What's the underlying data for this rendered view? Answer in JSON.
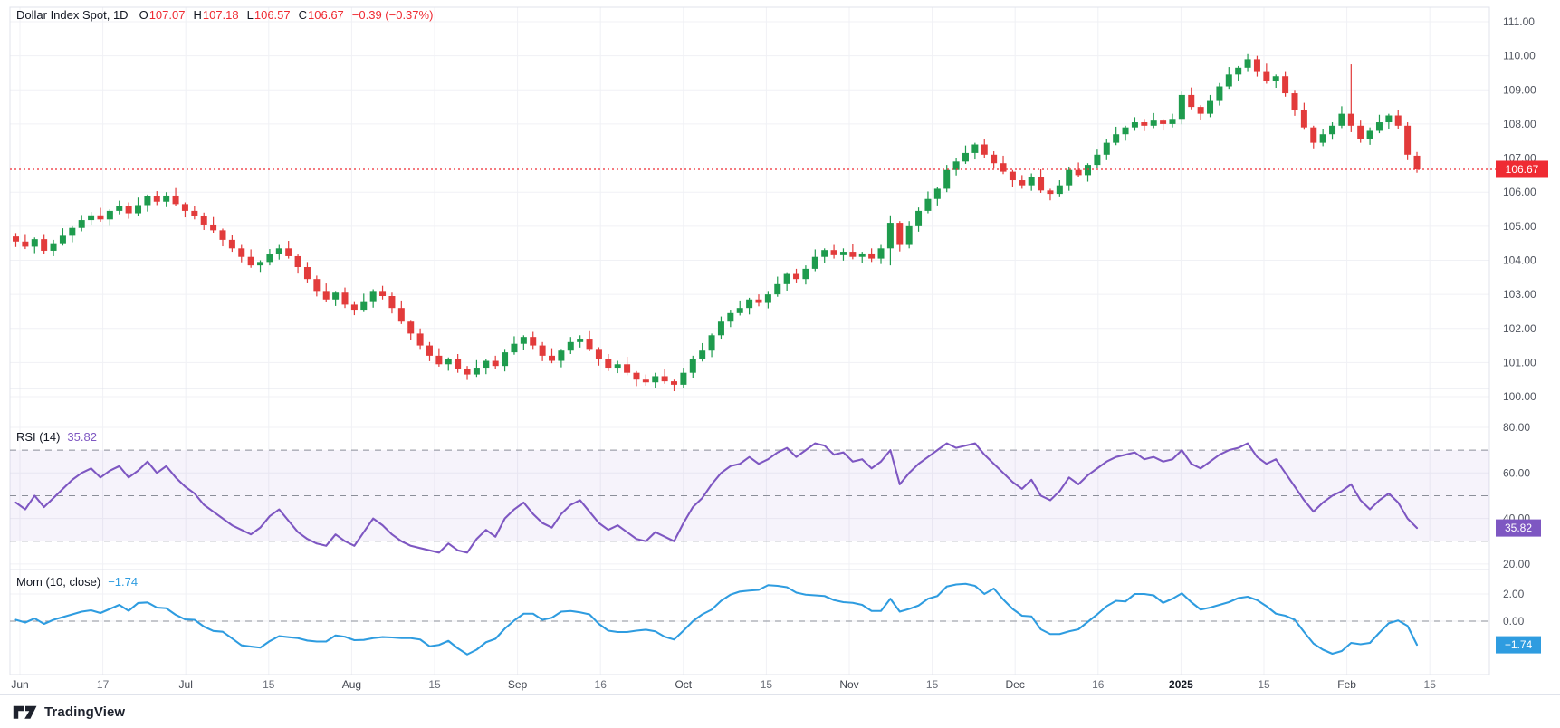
{
  "legend": {
    "title": "Dollar Index Spot, 1D",
    "ohlc": [
      {
        "label": "O",
        "value": "107.07"
      },
      {
        "label": "H",
        "value": "107.18"
      },
      {
        "label": "L",
        "value": "106.57"
      },
      {
        "label": "C",
        "value": "106.67"
      }
    ],
    "change": "−0.39 (−0.37%)"
  },
  "rsi_legend": {
    "title": "RSI (14)",
    "value": "35.82"
  },
  "mom_legend": {
    "title": "Mom (10, close)",
    "value": "−1.74"
  },
  "price_axis": {
    "labels": [
      "111.00",
      "110.00",
      "109.00",
      "108.00",
      "107.00",
      "106.00",
      "105.00",
      "104.00",
      "103.00",
      "102.00",
      "101.00",
      "100.00"
    ],
    "badge": "106.67"
  },
  "rsi_axis": {
    "labels": [
      "80.00",
      "60.00",
      "40.00",
      "20.00"
    ],
    "badge": "35.82"
  },
  "mom_axis": {
    "labels": [
      "2.00",
      "0.00"
    ],
    "badge": "−1.74"
  },
  "time_axis": {
    "ticks": [
      {
        "t": "Jun",
        "k": "month"
      },
      {
        "t": "17",
        "k": "day"
      },
      {
        "t": "Jul",
        "k": "month"
      },
      {
        "t": "15",
        "k": "day"
      },
      {
        "t": "Aug",
        "k": "month"
      },
      {
        "t": "15",
        "k": "day"
      },
      {
        "t": "Sep",
        "k": "month"
      },
      {
        "t": "16",
        "k": "day"
      },
      {
        "t": "Oct",
        "k": "month"
      },
      {
        "t": "15",
        "k": "day"
      },
      {
        "t": "Nov",
        "k": "month"
      },
      {
        "t": "15",
        "k": "day"
      },
      {
        "t": "Dec",
        "k": "month"
      },
      {
        "t": "16",
        "k": "day"
      },
      {
        "t": "2025",
        "k": "year"
      },
      {
        "t": "15",
        "k": "day"
      },
      {
        "t": "Feb",
        "k": "month"
      },
      {
        "t": "15",
        "k": "day"
      }
    ]
  },
  "footer": {
    "brand": "TradingView"
  },
  "colors": {
    "up": "#1e9b4d",
    "down": "#e23b3b",
    "last_price": "#ef2b33",
    "rsi": "#7e57c2",
    "rsi_band": "rgba(126,87,194,0.07)",
    "rsi_badge": "#7e57c2",
    "mom": "#2e9ce0",
    "grid": "#f0f1f5",
    "dashed": "#8b8f99",
    "axis_text": "#50545e",
    "day_text": "#6b6f79",
    "month_text": "#42464f",
    "year_text": "#131722",
    "legend_text": "#131722",
    "border": "#e0e3eb",
    "brand": "#1e222d"
  },
  "chart_data": [
    {
      "type": "candlestick",
      "title": "Dollar Index Spot",
      "timeframe": "1D",
      "ylim": [
        100,
        111
      ],
      "x_range": [
        "Jun 2024",
        "Feb 2025"
      ],
      "last_bar": {
        "open": 107.07,
        "high": 107.18,
        "low": 106.57,
        "close": 106.67,
        "change": -0.39,
        "change_pct": -0.37
      },
      "open_rule": "previous_close",
      "first_open": 104.7,
      "wick_high_cycle": [
        0.1,
        0.22,
        0.05,
        0.15
      ],
      "wick_low_cycle": [
        0.16,
        0.07,
        0.19,
        0.1
      ],
      "special": {
        "93": {
          "l": 103.85
        },
        "142": {
          "h": 109.75
        },
        "149": {
          "o": 107.07,
          "h": 107.18,
          "l": 106.57
        }
      },
      "closes": [
        104.55,
        104.4,
        104.62,
        104.28,
        104.5,
        104.72,
        104.95,
        105.18,
        105.32,
        105.2,
        105.45,
        105.6,
        105.38,
        105.62,
        105.88,
        105.72,
        105.9,
        105.65,
        105.45,
        105.3,
        105.05,
        104.88,
        104.6,
        104.35,
        104.1,
        103.85,
        103.95,
        104.18,
        104.35,
        104.12,
        103.8,
        103.45,
        103.1,
        102.85,
        103.05,
        102.7,
        102.55,
        102.8,
        103.1,
        102.95,
        102.6,
        102.2,
        101.85,
        101.5,
        101.2,
        100.95,
        101.1,
        100.8,
        100.65,
        100.85,
        101.05,
        100.9,
        101.3,
        101.55,
        101.75,
        101.5,
        101.2,
        101.05,
        101.35,
        101.6,
        101.7,
        101.4,
        101.1,
        100.85,
        100.95,
        100.7,
        100.5,
        100.42,
        100.6,
        100.45,
        100.35,
        100.7,
        101.1,
        101.35,
        101.8,
        102.2,
        102.45,
        102.6,
        102.85,
        102.75,
        103.0,
        103.3,
        103.6,
        103.45,
        103.75,
        104.1,
        104.3,
        104.15,
        104.25,
        104.1,
        104.2,
        104.05,
        104.35,
        105.1,
        104.45,
        105.0,
        105.45,
        105.8,
        106.1,
        106.65,
        106.9,
        107.15,
        107.4,
        107.1,
        106.85,
        106.6,
        106.35,
        106.2,
        106.45,
        106.05,
        105.95,
        106.2,
        106.65,
        106.5,
        106.8,
        107.1,
        107.45,
        107.7,
        107.9,
        108.05,
        107.95,
        108.1,
        108.0,
        108.15,
        108.85,
        108.5,
        108.3,
        108.7,
        109.1,
        109.45,
        109.65,
        109.9,
        109.55,
        109.25,
        109.4,
        108.9,
        108.4,
        107.9,
        107.45,
        107.7,
        107.95,
        108.3,
        107.95,
        107.55,
        107.8,
        108.05,
        108.25,
        107.95,
        107.1,
        106.67
      ]
    },
    {
      "type": "line",
      "name": "RSI (14)",
      "last": 35.82,
      "ylim_visible": [
        20,
        80
      ],
      "band": [
        30,
        70
      ],
      "levels_dashed": [
        70,
        50,
        30
      ],
      "values": [
        47,
        44,
        50,
        45,
        49,
        53,
        57,
        60,
        62,
        58,
        61,
        63,
        58,
        61,
        65,
        60,
        63,
        58,
        54,
        51,
        46,
        43,
        40,
        37,
        35,
        33,
        36,
        41,
        44,
        39,
        34,
        31,
        29,
        28,
        33,
        30,
        28,
        34,
        40,
        37,
        33,
        30,
        28,
        27,
        26,
        25,
        29,
        26,
        25,
        31,
        35,
        32,
        40,
        44,
        47,
        42,
        38,
        36,
        42,
        46,
        48,
        43,
        38,
        35,
        37,
        34,
        31,
        30,
        34,
        32,
        30,
        38,
        45,
        49,
        55,
        60,
        63,
        64,
        67,
        64,
        66,
        69,
        71,
        67,
        70,
        73,
        72,
        68,
        69,
        65,
        66,
        62,
        65,
        70,
        55,
        60,
        64,
        67,
        70,
        73,
        71,
        72,
        73,
        68,
        64,
        60,
        56,
        53,
        57,
        50,
        48,
        52,
        58,
        55,
        59,
        62,
        65,
        67,
        68,
        69,
        66,
        67,
        65,
        66,
        70,
        64,
        62,
        65,
        68,
        70,
        71,
        73,
        67,
        64,
        66,
        60,
        54,
        48,
        43,
        47,
        50,
        52,
        55,
        48,
        44,
        48,
        51,
        47,
        40,
        35.82
      ]
    },
    {
      "type": "line",
      "name": "Mom (10, close)",
      "last": -1.74,
      "zero_line": 0,
      "values": [
        0.1,
        -0.1,
        0.2,
        -0.2,
        0.1,
        0.3,
        0.5,
        0.7,
        0.8,
        0.6,
        0.9,
        1.2,
        0.76,
        1.34,
        1.38,
        1.0,
        0.95,
        0.47,
        0.13,
        0.1,
        -0.4,
        -0.72,
        -0.78,
        -1.27,
        -1.78,
        -1.87,
        -1.95,
        -1.47,
        -1.1,
        -1.18,
        -1.25,
        -1.43,
        -1.5,
        -1.5,
        -1.05,
        -1.15,
        -1.4,
        -1.38,
        -1.25,
        -1.17,
        -1.2,
        -1.25,
        -1.25,
        -1.35,
        -1.85,
        -1.75,
        -1.45,
        -2.0,
        -2.45,
        -2.1,
        -1.55,
        -1.3,
        -0.55,
        0.05,
        0.55,
        0.55,
        0.1,
        0.25,
        0.7,
        0.75,
        0.65,
        0.5,
        -0.2,
        -0.7,
        -0.8,
        -0.8,
        -0.7,
        -0.63,
        -0.75,
        -1.15,
        -1.35,
        -0.7,
        0.0,
        0.5,
        0.85,
        1.5,
        1.95,
        2.18,
        2.25,
        2.3,
        2.65,
        2.6,
        2.5,
        2.1,
        1.95,
        1.9,
        1.85,
        1.55,
        1.4,
        1.35,
        1.2,
        0.75,
        0.75,
        1.65,
        0.7,
        0.9,
        1.15,
        1.65,
        1.85,
        2.55,
        2.7,
        2.75,
        2.6,
        2.0,
        2.4,
        1.6,
        0.9,
        0.4,
        0.35,
        -0.6,
        -0.95,
        -0.95,
        -0.75,
        -0.6,
        -0.05,
        0.5,
        1.1,
        1.5,
        1.45,
        2.0,
        2.0,
        1.9,
        1.35,
        1.65,
        2.05,
        1.4,
        0.85,
        1.0,
        1.2,
        1.4,
        1.7,
        1.8,
        1.55,
        1.1,
        0.55,
        0.4,
        0.1,
        -0.8,
        -1.65,
        -2.1,
        -2.4,
        -2.2,
        -1.6,
        -1.7,
        -1.6,
        -0.85,
        -0.15,
        0.05,
        -0.35,
        -1.74
      ]
    }
  ]
}
